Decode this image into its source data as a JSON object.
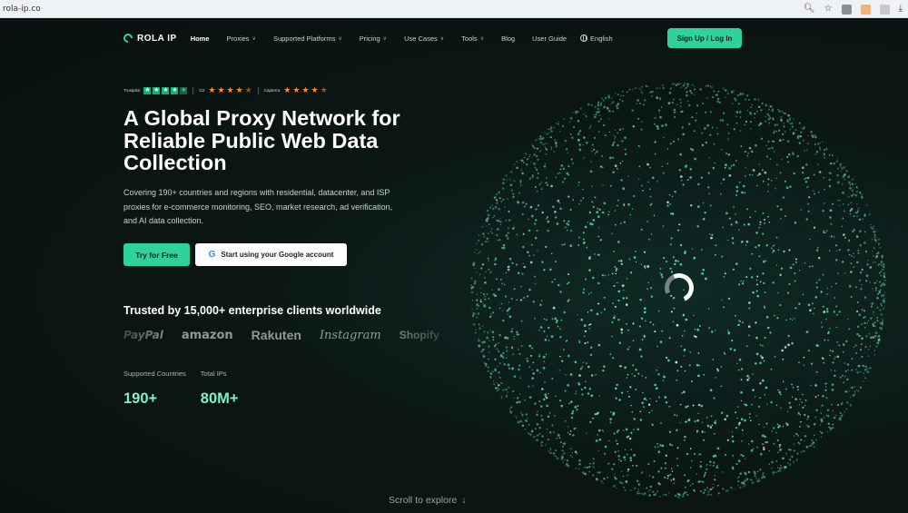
{
  "browser": {
    "url": "rola-ip.co"
  },
  "nav": {
    "brand": "ROLA IP",
    "items": [
      {
        "label": "Home",
        "active": true,
        "dropdown": false
      },
      {
        "label": "Proxies",
        "dropdown": true
      },
      {
        "label": "Supported Platforms",
        "dropdown": true
      },
      {
        "label": "Pricing",
        "dropdown": true
      },
      {
        "label": "Use Cases",
        "dropdown": true
      },
      {
        "label": "Tools",
        "dropdown": true
      },
      {
        "label": "Blog",
        "dropdown": false
      },
      {
        "label": "User Guide",
        "dropdown": false
      }
    ],
    "language": "English",
    "signup": "Sign Up / Log In"
  },
  "ratings": [
    {
      "source": "Trustpilot",
      "stars": 4.5
    },
    {
      "source": "G2",
      "stars": 4.5
    },
    {
      "source": "Capterra",
      "stars": 4.5
    }
  ],
  "hero": {
    "title": "A Global Proxy Network for Reliable Public Web Data Collection",
    "description": "Covering 190+ countries and regions with residential, datacenter, and ISP proxies for e-commerce monitoring, SEO, market research, ad verification, and AI data collection.",
    "cta_primary": "Try for Free",
    "cta_google": "Start using your Google account"
  },
  "trusted": {
    "heading": "Trusted by 15,000+ enterprise clients worldwide",
    "clients": [
      "PayPal",
      "amazon",
      "Rakuten",
      "Instagram",
      "Shopify"
    ]
  },
  "stats": [
    {
      "label": "Supported Countries",
      "value": "190+"
    },
    {
      "label": "Total IPs",
      "value": "80M+"
    }
  ],
  "scroll_hint": "Scroll to explore",
  "colors": {
    "accent": "#2fd39a",
    "stat": "#7ff0c8",
    "background": "#0b1312"
  }
}
